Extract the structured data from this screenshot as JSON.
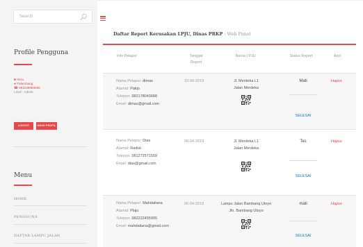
{
  "sidebar": {
    "search_placeholder": "Search",
    "profile_title": "Profile Pengguna",
    "user_name": "Heru",
    "user_location": "Palembang",
    "user_phone": "081238886666",
    "user_level": "Level : Admin",
    "logout_label": "LOGOUT",
    "edit_profile_label": "UBAH PROFIL",
    "menu_title": "Menu",
    "menu_items": [
      "HOME",
      "PENGGUNA",
      "DAFTAR LAMPU JALAN"
    ]
  },
  "page": {
    "title": "Daftar Report Kerusakan LPJU, Dinas PRKP",
    "subtitle": "- Web Panel"
  },
  "table": {
    "headers": {
      "pelapor": "Info Pelapor",
      "tanggal_1": "Tanggal",
      "tanggal_2": "Report",
      "lpju": "Nama LPJU",
      "status": "Status Report",
      "aksi": "Aksi"
    },
    "labels": {
      "nama": "Nama Pelapor: ",
      "alamat": "Alamat: ",
      "telepon": "Telepon: ",
      "email": "Email: "
    },
    "rows": [
      {
        "nama": "dimas",
        "alamat": "Pakjo",
        "telepon": "082178043688",
        "email": "dimas@gmail.com",
        "tanggal": "10-06-2019",
        "lpju_1": "Jl. Merdeka L1",
        "lpju_2": "Jalan Merdeka",
        "status": "Mati",
        "progress": "SELESAI",
        "aksi": "Hapus"
      },
      {
        "nama": "Dias",
        "alamat": "Radial",
        "telepon": "081272571559",
        "email": "dias@gmail.com",
        "tanggal": "08-04-2019",
        "lpju_1": "Jl. Merdeka L1",
        "lpju_2": "Jalan Merdeka",
        "status": "Tes",
        "progress": "SELESAI",
        "aksi": "Hapus"
      },
      {
        "nama": "Mahdaliana",
        "alamat": "Plaju",
        "telepon": "082222455905",
        "email": "mahdaliana@gmail.com",
        "tanggal": "06-04-2019",
        "lpju_1": "Lampu Jalan Bambang Utoyo",
        "lpju_2": "Jln. Bambang Utoyo",
        "status": "mati",
        "progress": "SELESAI",
        "aksi": "Hapus"
      }
    ]
  },
  "colors": {
    "accent": "#e8474d",
    "link": "#1e73be"
  },
  "icons": [
    "search-icon",
    "menu-icon",
    "user-icon",
    "location-icon",
    "phone-icon",
    "qr-code-icon"
  ]
}
